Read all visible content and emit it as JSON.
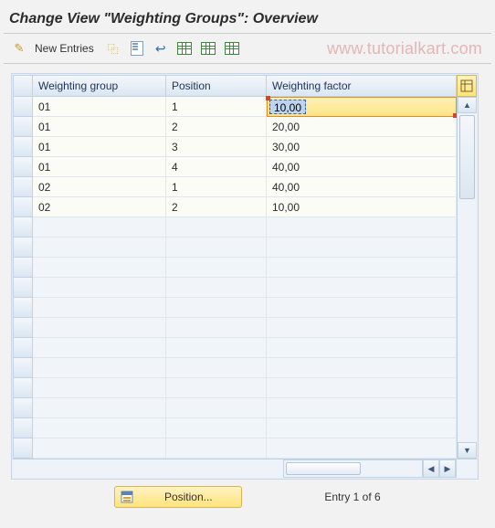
{
  "title": "Change View \"Weighting Groups\": Overview",
  "watermark": "www.tutorialkart.com",
  "toolbar": {
    "new_entries_label": "New Entries"
  },
  "grid": {
    "headers": {
      "weighting_group": "Weighting group",
      "position": "Position",
      "weighting_factor": "Weighting factor"
    },
    "rows": [
      {
        "group": "01",
        "position": "1",
        "factor": "10,00",
        "selected": true
      },
      {
        "group": "01",
        "position": "2",
        "factor": "20,00"
      },
      {
        "group": "01",
        "position": "3",
        "factor": "30,00"
      },
      {
        "group": "01",
        "position": "4",
        "factor": "40,00"
      },
      {
        "group": "02",
        "position": "1",
        "factor": "40,00"
      },
      {
        "group": "02",
        "position": "2",
        "factor": "10,00"
      }
    ],
    "empty_rows": 12
  },
  "footer": {
    "position_button": "Position...",
    "entry_text": "Entry 1 of 6"
  }
}
